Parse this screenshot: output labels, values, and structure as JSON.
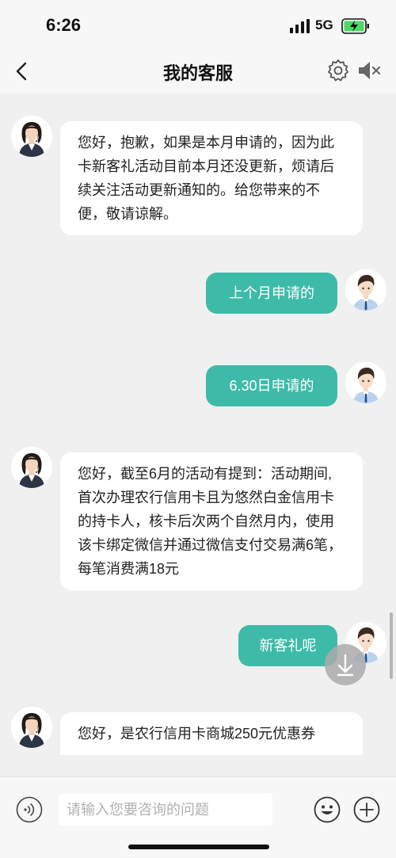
{
  "status_bar": {
    "time": "6:26",
    "network": "5G",
    "signal_icon": "signal-bars-icon",
    "battery_icon": "battery-charging-icon",
    "battery_color": "#4cd964"
  },
  "header": {
    "title": "我的客服",
    "back_icon": "chevron-left-icon",
    "settings_icon": "gear-icon",
    "sound_icon": "speaker-muted-icon"
  },
  "messages": [
    {
      "from": "agent",
      "text": "您好，抱歉，如果是本月申请的，因为此卡新客礼活动目前本月还没更新，烦请后续关注活动更新通知的。给您带来的不便，敬请谅解。"
    },
    {
      "from": "user",
      "text": "上个月申请的"
    },
    {
      "from": "user",
      "text": "6.30日申请的"
    },
    {
      "from": "agent",
      "text": "您好，截至6月的活动有提到：活动期间,首次办理农行信用卡且为悠然白金信用卡的持卡人，核卡后次两个自然月内，使用该卡绑定微信并通过微信支付交易满6笔，每笔消费满18元"
    },
    {
      "from": "user",
      "text": "新客礼呢"
    },
    {
      "from": "agent",
      "text": "您好，是农行信用卡商城250元优惠券"
    }
  ],
  "input_bar": {
    "placeholder": "请输入您要咨询的问题",
    "value": "",
    "voice_icon": "voice-wave-icon",
    "emoji_icon": "smiley-icon",
    "more_icon": "plus-circle-icon"
  },
  "scroll_down_icon": "arrow-down-icon",
  "colors": {
    "accent": "#3dbba8",
    "background": "#f0f0f0",
    "bubble_in": "#ffffff"
  }
}
